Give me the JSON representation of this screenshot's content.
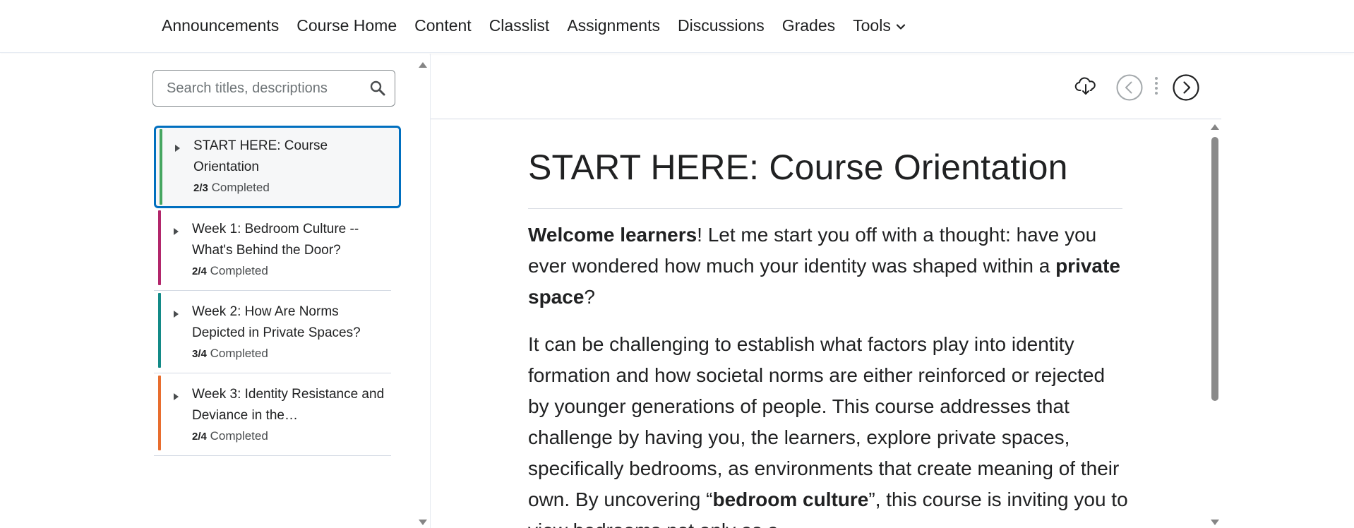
{
  "nav": {
    "items": [
      {
        "label": "Announcements"
      },
      {
        "label": "Course Home"
      },
      {
        "label": "Content"
      },
      {
        "label": "Classlist"
      },
      {
        "label": "Assignments"
      },
      {
        "label": "Discussions"
      },
      {
        "label": "Grades"
      }
    ],
    "tools_label": "Tools"
  },
  "sidebar": {
    "search_placeholder": "Search titles, descriptions",
    "modules": [
      {
        "title": "START HERE: Course Orientation",
        "progress_fraction": "2/3",
        "progress_label": "Completed",
        "color": "#46a661",
        "active": true
      },
      {
        "title": "Week 1: Bedroom Culture -- What's Behind the Door?",
        "progress_fraction": "2/4",
        "progress_label": "Completed",
        "color": "#b2266b",
        "active": false
      },
      {
        "title": "Week 2: How Are Norms Depicted in Private Spaces?",
        "progress_fraction": "3/4",
        "progress_label": "Completed",
        "color": "#138a87",
        "active": false
      },
      {
        "title": "Week 3: Identity Resistance and Deviance in the…",
        "progress_fraction": "2/4",
        "progress_label": "Completed",
        "color": "#e86d2e",
        "active": false
      }
    ]
  },
  "toolbar": {
    "download_icon": "cloud-download-icon",
    "prev_icon": "chevron-left-circle-icon",
    "next_icon": "chevron-right-circle-icon"
  },
  "document": {
    "title": "START HERE: Course Orientation",
    "p1": {
      "b1": "Welcome learners",
      "t1": "! Let me start you off with a thought: have you ever wondered how much your identity was shaped within a ",
      "b2": "private space",
      "t2": "?"
    },
    "p2": {
      "t1": "It can be challenging to establish what factors play into identity formation and how societal norms are either reinforced or rejected by younger generations of people. This course addresses that challenge by having you, the learners, explore private spaces, specifically bedrooms, as environments that create meaning of their own. By uncovering “",
      "b1": "bedroom culture",
      "t2": "”, this course is inviting you to view bedrooms not only as a"
    }
  },
  "colors": {
    "accent": "#006fbf",
    "text": "#202122"
  }
}
